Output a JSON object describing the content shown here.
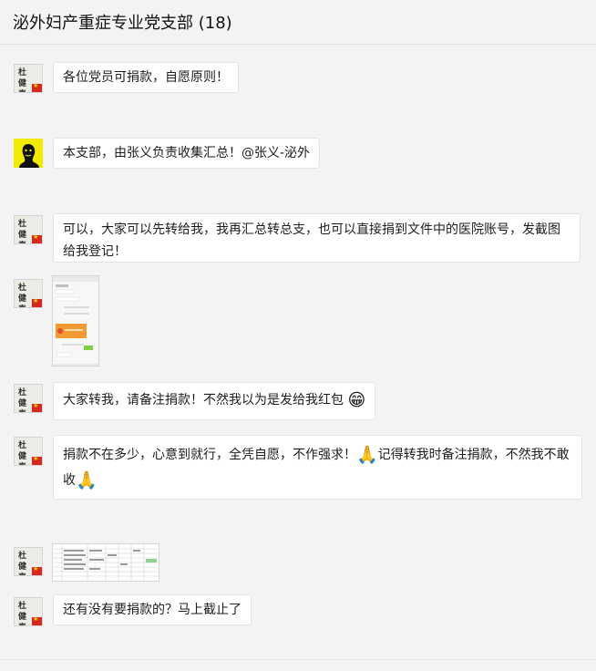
{
  "header": {
    "title": "泌外妇产重症专业党支部 (18)"
  },
  "avatar_text": "杜 健\n春 鼎",
  "messages": [
    {
      "text": "各位党员可捐款，自愿原则！"
    },
    {
      "text": "本支部，由张义负责收集汇总！@张义-泌外"
    },
    {
      "text": "可以，大家可以先转给我，我再汇总转总支，也可以直接捐到文件中的医院账号，发截图给我登记！"
    },
    {
      "type": "image",
      "icon": "chat-screenshot-thumbnail"
    },
    {
      "text": "大家转我，请备注捐款！不然我以为是发给我红包",
      "emoji": "😁",
      "emoji_icon": "grin-emoji-icon"
    },
    {
      "text_a": "捐款不在多少，心意到就行，全凭自愿，不作强求！",
      "emoji_a": "🙏",
      "text_b": "记得转我时备注捐款，不然我不敢收",
      "emoji_b": "🙏",
      "emoji_icon": "clasp-hands-emoji-icon"
    },
    {
      "type": "image",
      "icon": "spreadsheet-thumbnail"
    },
    {
      "text": "还有没有要捐款的？马上截止了"
    }
  ],
  "colors": {
    "background": "#f3f3f3",
    "bubble": "#ffffff",
    "flag": "#d8281e",
    "photo_avatar": "#f2ea00"
  }
}
